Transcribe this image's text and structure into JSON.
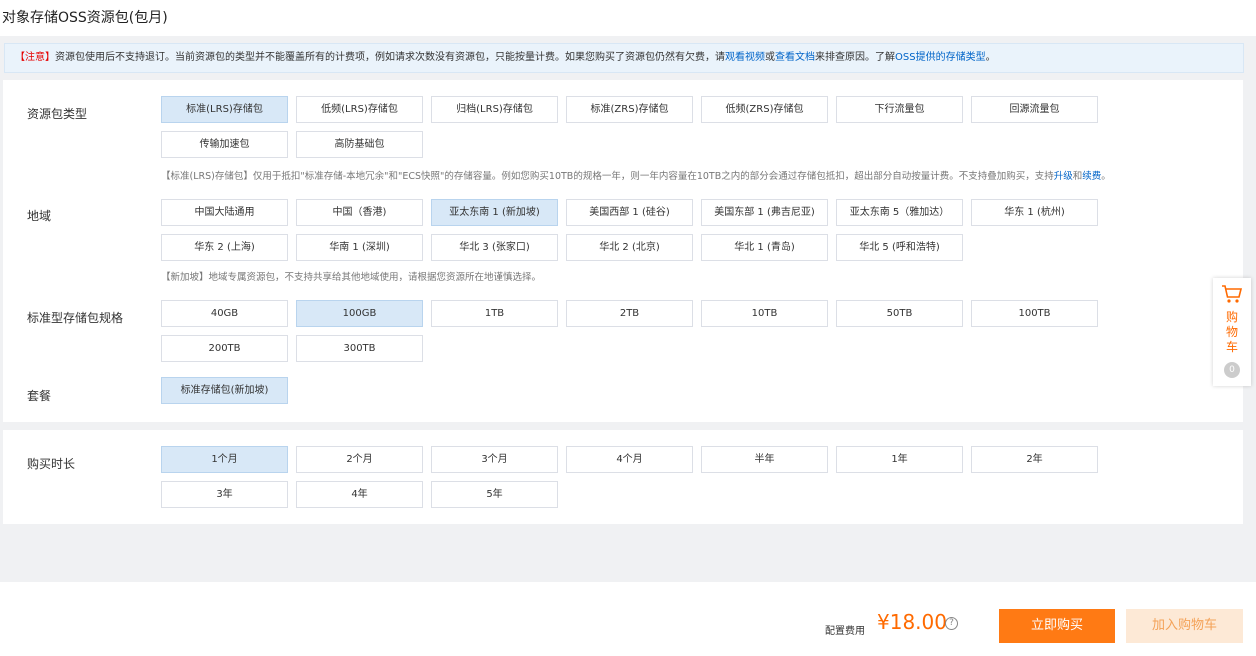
{
  "page": {
    "title": "对象存储OSS资源包(包月)"
  },
  "notice": {
    "tag": "【注意】",
    "text1": "资源包使用后不支持退订。当前资源包的类型并不能覆盖所有的计费项，例如请求次数没有资源包，只能按量计费。如果您购买了资源包仍然有欠费，请",
    "link1": "观看视频",
    "or": "或",
    "link2": "查看文档",
    "text2": "来排查原因。了解",
    "link3": "OSS提供的存储类型",
    "end": "。"
  },
  "package_type": {
    "label": "资源包类型",
    "options": [
      "标准(LRS)存储包",
      "低频(LRS)存储包",
      "归档(LRS)存储包",
      "标准(ZRS)存储包",
      "低频(ZRS)存储包",
      "下行流量包",
      "回源流量包",
      "传输加速包",
      "高防基础包"
    ],
    "selected": "标准(LRS)存储包",
    "hint_pre": "【标准(LRS)存储包】仅用于抵扣\"标准存储-本地冗余\"和\"ECS快照\"的存储容量。例如您购买10TB的规格一年，则一年内容量在10TB之内的部分会通过存储包抵扣，超出部分自动按量计费。不支持叠加购买，支持",
    "hint_link1": "升级",
    "hint_and": "和",
    "hint_link2": "续费",
    "hint_end": "。"
  },
  "region": {
    "label": "地域",
    "options": [
      "中国大陆通用",
      "中国（香港)",
      "亚太东南 1 (新加坡)",
      "美国西部 1 (硅谷)",
      "美国东部 1 (弗吉尼亚)",
      "亚太东南 5（雅加达）",
      "华东 1 (杭州)",
      "华东 2 (上海)",
      "华南 1 (深圳)",
      "华北 3 (张家口)",
      "华北 2 (北京)",
      "华北 1 (青岛)",
      "华北 5 (呼和浩特)"
    ],
    "selected": "亚太东南 1 (新加坡)",
    "hint": "【新加坡】地域专属资源包，不支持共享给其他地域使用，请根据您资源所在地谨慎选择。"
  },
  "spec": {
    "label": "标准型存储包规格",
    "options": [
      "40GB",
      "100GB",
      "1TB",
      "2TB",
      "10TB",
      "50TB",
      "100TB",
      "200TB",
      "300TB"
    ],
    "selected": "100GB"
  },
  "plan": {
    "label": "套餐",
    "options": [
      "标准存储包(新加坡)"
    ],
    "selected": "标准存储包(新加坡)"
  },
  "duration": {
    "label": "购买时长",
    "options": [
      "1个月",
      "2个月",
      "3个月",
      "4个月",
      "半年",
      "1年",
      "2年",
      "3年",
      "4年",
      "5年"
    ],
    "selected": "1个月"
  },
  "footer": {
    "fee_label": "配置费用",
    "price": "¥18.00",
    "help": "?",
    "buy_label": "立即购买",
    "add_cart_label": "加入购物车"
  },
  "cart_side": {
    "text": "购\n物\n车",
    "count": "0"
  },
  "colors": {
    "accent": "#ff6a00",
    "selected_bg": "#d8e8f7",
    "link": "#0064c8",
    "warn": "#e60000"
  }
}
